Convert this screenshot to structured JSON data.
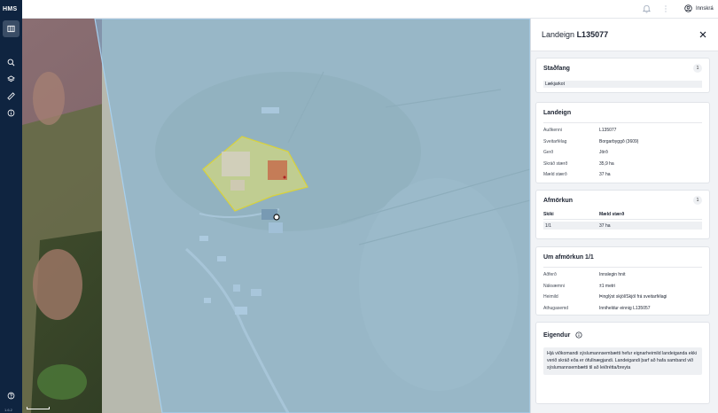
{
  "app": {
    "logo": "HMS",
    "version": "1.6.2"
  },
  "topbar": {
    "login_label": "Innskrá"
  },
  "panel": {
    "title_prefix": "Landeign",
    "title_id": "L135077",
    "stadfang": {
      "title": "Staðfang",
      "count": "1",
      "address": "Lækjarkot"
    },
    "landeign": {
      "title": "Landeign",
      "rows": [
        {
          "label": "Auðkenni",
          "value": "L135077"
        },
        {
          "label": "Sveitarfélag",
          "value": "Borgarbyggð (3609)"
        },
        {
          "label": "Gerð",
          "value": "Jörð"
        },
        {
          "label": "Skráð stærð",
          "value": "35,9 ha"
        },
        {
          "label": "Mæld stærð",
          "value": "37 ha"
        }
      ]
    },
    "afmorkun": {
      "title": "Afmörkun",
      "count": "1",
      "col1": "Skiki",
      "col2": "Mæld stærð",
      "row_c1": "1/1",
      "row_c2": "37 ha"
    },
    "um_afmorkun": {
      "title": "Um afmörkun 1/1",
      "rows": [
        {
          "label": "Aðferð",
          "value": "Innslegin hnit"
        },
        {
          "label": "Nákvæmni",
          "value": "±1 metri"
        },
        {
          "label": "Heimild",
          "value": "Þinglýst skjöl/Skjöl frá sveitarfélagi"
        },
        {
          "label": "Athugasemd",
          "value": "Inniheldur einnig L135057"
        }
      ]
    },
    "eigendur": {
      "title": "Eigendur",
      "text": "Hjá viðkomandi sýslumannsembætti hefur eignarheimild landeiganda ekki verið skráð eða er ófullnægjandi. Landeigandi þarf að hafa samband við sýslumannsembætti til að leiðrétta/breyta"
    }
  },
  "colors": {
    "rail": "#0f2440",
    "parcel_overlay": "#7fb6dc",
    "selected_parcel": "#e6e36a"
  }
}
